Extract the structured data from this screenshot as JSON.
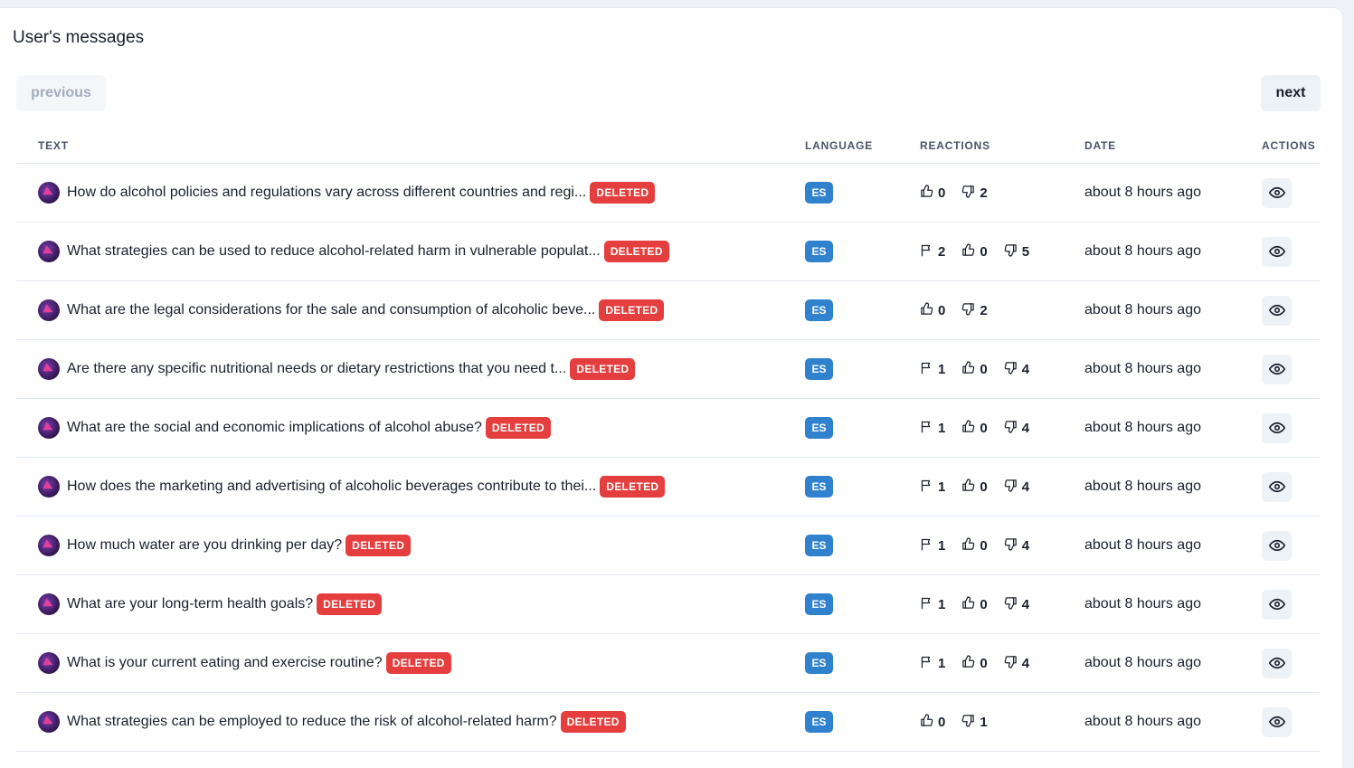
{
  "page": {
    "title": "User's messages",
    "prev_label": "previous",
    "next_label": "next"
  },
  "columns": {
    "text": "TEXT",
    "language": "LANGUAGE",
    "reactions": "REACTIONS",
    "date": "DATE",
    "actions": "ACTIONS"
  },
  "badge": "DELETED",
  "rows": [
    {
      "text": "How do alcohol policies and regulations vary across different countries and regi...",
      "lang": "ES",
      "flags": null,
      "up": "0",
      "down": "2",
      "date": "about 8 hours ago"
    },
    {
      "text": "What strategies can be used to reduce alcohol-related harm in vulnerable populat...",
      "lang": "ES",
      "flags": "2",
      "up": "0",
      "down": "5",
      "date": "about 8 hours ago"
    },
    {
      "text": "What are the legal considerations for the sale and consumption of alcoholic beve...",
      "lang": "ES",
      "flags": null,
      "up": "0",
      "down": "2",
      "date": "about 8 hours ago"
    },
    {
      "text": "Are there any specific nutritional needs or dietary restrictions that you need t...",
      "lang": "ES",
      "flags": "1",
      "up": "0",
      "down": "4",
      "date": "about 8 hours ago"
    },
    {
      "text": "What are the social and economic implications of alcohol abuse?",
      "lang": "ES",
      "flags": "1",
      "up": "0",
      "down": "4",
      "date": "about 8 hours ago"
    },
    {
      "text": "How does the marketing and advertising of alcoholic beverages contribute to thei...",
      "lang": "ES",
      "flags": "1",
      "up": "0",
      "down": "4",
      "date": "about 8 hours ago"
    },
    {
      "text": "How much water are you drinking per day?",
      "lang": "ES",
      "flags": "1",
      "up": "0",
      "down": "4",
      "date": "about 8 hours ago"
    },
    {
      "text": "What are your long-term health goals?",
      "lang": "ES",
      "flags": "1",
      "up": "0",
      "down": "4",
      "date": "about 8 hours ago"
    },
    {
      "text": "What is your current eating and exercise routine?",
      "lang": "ES",
      "flags": "1",
      "up": "0",
      "down": "4",
      "date": "about 8 hours ago"
    },
    {
      "text": "What strategies can be employed to reduce the risk of alcohol-related harm?",
      "lang": "ES",
      "flags": null,
      "up": "0",
      "down": "1",
      "date": "about 8 hours ago"
    }
  ],
  "icons": {
    "flag": "flag-icon",
    "thumbs_up": "thumbs-up-icon",
    "thumbs_down": "thumbs-down-icon",
    "view": "eye-icon"
  },
  "colors": {
    "deleted_badge": "#e53e3e",
    "language_badge": "#3182ce",
    "button_bg": "#edf2f7"
  }
}
